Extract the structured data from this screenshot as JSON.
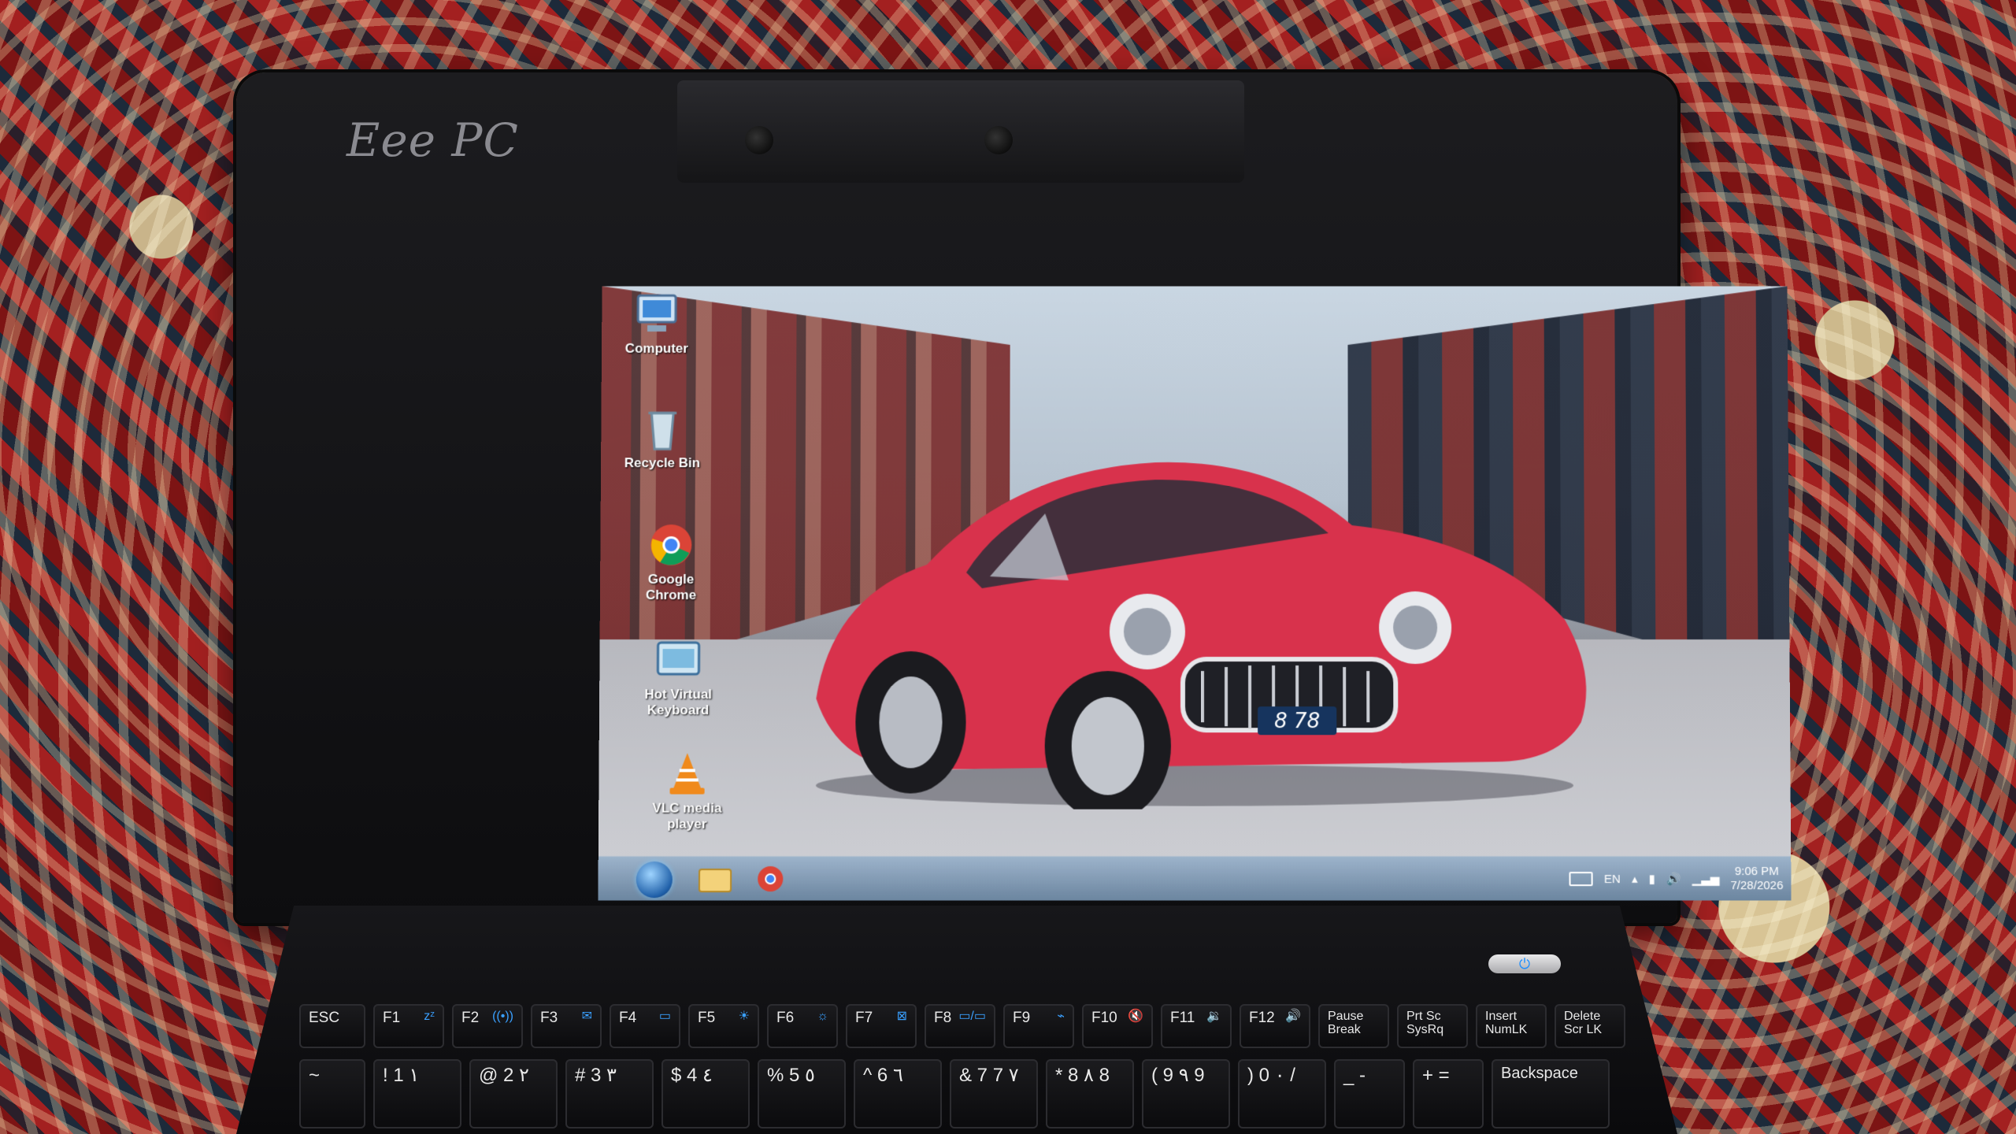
{
  "laptop": {
    "brand": "Eee PC",
    "power_icon": "⏻"
  },
  "desktop": {
    "icons": [
      {
        "label": "Computer",
        "icon": "computer-icon"
      },
      {
        "label": "Recycle Bin",
        "icon": "recycle-bin-icon"
      },
      {
        "label": "Google Chrome",
        "icon": "chrome-icon"
      },
      {
        "label": "Hot Virtual Keyboard",
        "icon": "keyboard-app-icon"
      },
      {
        "label": "VLC media player",
        "icon": "vlc-icon"
      }
    ],
    "wallpaper": {
      "plate": "8 78"
    }
  },
  "taskbar": {
    "pinned": [
      "start-orb",
      "file-explorer-icon",
      "chrome-icon"
    ],
    "language": "EN",
    "time": "9:06 PM",
    "date": "7/28/2026"
  },
  "keyboard": {
    "function_row": [
      {
        "label": "ESC"
      },
      {
        "label": "F1",
        "fn": "zᶻ"
      },
      {
        "label": "F2",
        "fn": "((•))"
      },
      {
        "label": "F3",
        "fn": "✉"
      },
      {
        "label": "F4",
        "fn": "▭"
      },
      {
        "label": "F5",
        "fn": "☀"
      },
      {
        "label": "F6",
        "fn": "☼"
      },
      {
        "label": "F7",
        "fn": "⊠"
      },
      {
        "label": "F8",
        "fn": "▭/▭"
      },
      {
        "label": "F9",
        "fn": "⌁"
      },
      {
        "label": "F10",
        "fn": "🔇"
      },
      {
        "label": "F11",
        "fn": "🔉"
      },
      {
        "label": "F12",
        "fn": "🔊"
      },
      {
        "label": "Pause Break"
      },
      {
        "label": "Prt Sc SysRq"
      },
      {
        "label": "Insert NumLK"
      },
      {
        "label": "Delete Scr LK"
      }
    ],
    "number_row": [
      {
        "label": "~"
      },
      {
        "label": "! 1 ۱"
      },
      {
        "label": "@ 2 ۲"
      },
      {
        "label": "# 3 ۳"
      },
      {
        "label": "$ 4 ٤"
      },
      {
        "label": "% 5 ٥"
      },
      {
        "label": "^ 6 ٦"
      },
      {
        "label": "& 7 7 ٧"
      },
      {
        "label": "* 8 ٨ 8"
      },
      {
        "label": "( 9 ٩ 9"
      },
      {
        "label": ") 0 ٠ /"
      },
      {
        "label": "_ -"
      },
      {
        "label": "+ ="
      },
      {
        "label": "Backspace"
      }
    ]
  },
  "colors": {
    "car_red": "#d8324c",
    "bezel": "#141416",
    "taskbar": "#6f93b8"
  }
}
